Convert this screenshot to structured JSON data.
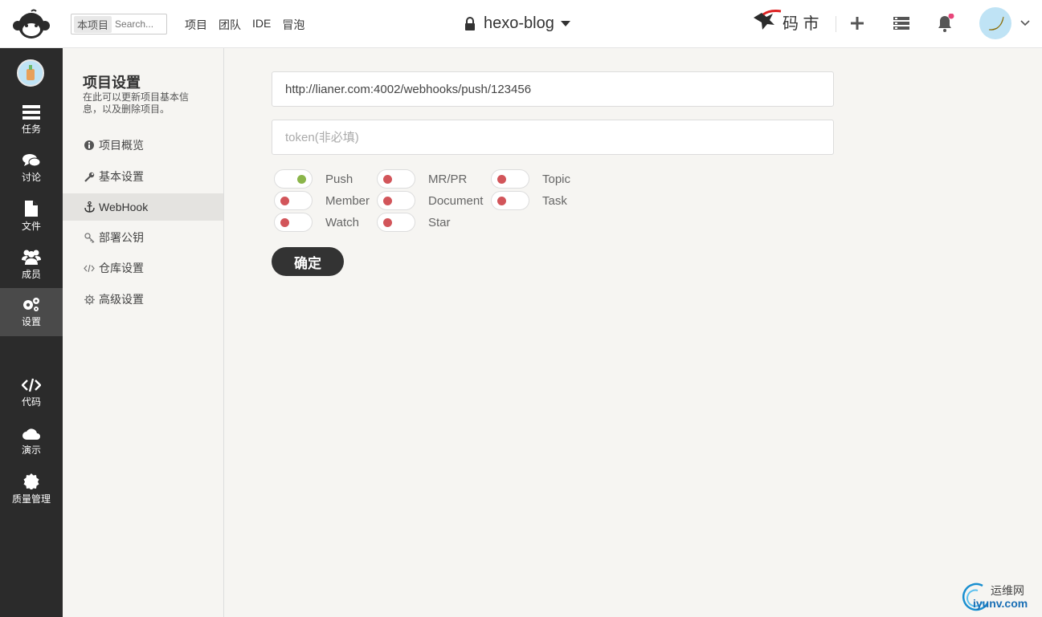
{
  "header": {
    "search_scope": "本项目",
    "search_placeholder": "Search...",
    "nav": [
      "项目",
      "团队",
      "IDE",
      "冒泡"
    ],
    "project_name": "hexo-blog",
    "market_logo_text": "码 市"
  },
  "sidebar": {
    "items": [
      {
        "label": "任务",
        "icon": "tasks-icon"
      },
      {
        "label": "讨论",
        "icon": "comments-icon"
      },
      {
        "label": "文件",
        "icon": "file-icon"
      },
      {
        "label": "成员",
        "icon": "users-icon"
      },
      {
        "label": "设置",
        "icon": "gears-icon",
        "active": true
      },
      {
        "label": "代码",
        "icon": "code-icon"
      },
      {
        "label": "演示",
        "icon": "cloud-icon"
      },
      {
        "label": "质量管理",
        "icon": "badge-icon"
      }
    ]
  },
  "settings": {
    "title": "项目设置",
    "description": "在此可以更新项目基本信息，以及删除项目。",
    "nav": [
      {
        "label": "项目概览",
        "icon": "info-icon"
      },
      {
        "label": "基本设置",
        "icon": "wrench-icon"
      },
      {
        "label": "WebHook",
        "icon": "anchor-icon",
        "active": true
      },
      {
        "label": "部署公钥",
        "icon": "key-icon"
      },
      {
        "label": "仓库设置",
        "icon": "code-icon"
      },
      {
        "label": "高级设置",
        "icon": "cog-icon"
      }
    ]
  },
  "form": {
    "url_value": "http://lianer.com:4002/webhooks/push/123456",
    "token_placeholder": "token(非必填)",
    "events": [
      {
        "label": "Push",
        "enabled": true
      },
      {
        "label": "MR/PR",
        "enabled": false
      },
      {
        "label": "Topic",
        "enabled": false
      },
      {
        "label": "Member",
        "enabled": false
      },
      {
        "label": "Document",
        "enabled": false
      },
      {
        "label": "Task",
        "enabled": false
      },
      {
        "label": "Watch",
        "enabled": false
      },
      {
        "label": "Star",
        "enabled": false
      }
    ],
    "confirm_label": "确定"
  },
  "watermark": {
    "cn": "运维网",
    "en": "iyunv.com"
  },
  "colors": {
    "sidebar_bg": "#2b2b2b",
    "toggle_on": "#8bb54a",
    "toggle_off": "#d2555a",
    "notification_dot": "#e8457a"
  }
}
